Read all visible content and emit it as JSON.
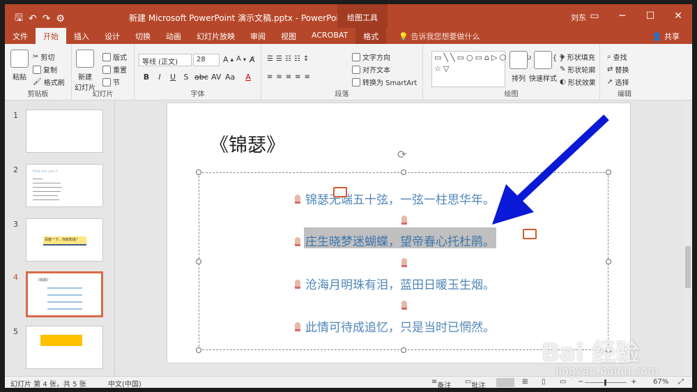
{
  "app": {
    "doc_title": "新建 Microsoft PowerPoint 演示文稿.pptx  -  PowerPoint",
    "context_tools": "绘图工具",
    "user": "刘东"
  },
  "tabs": [
    "文件",
    "开始",
    "插入",
    "设计",
    "切换",
    "动画",
    "幻灯片放映",
    "审阅",
    "视图",
    "ACROBAT",
    "格式"
  ],
  "active_tab": "开始",
  "tellme": "告诉我您想要做什么",
  "share": "共享",
  "ribbon": {
    "clipboard": {
      "paste": "粘贴",
      "cut": "剪切",
      "copy": "复制",
      "format_painter": "格式刷",
      "label": "剪贴板"
    },
    "slides": {
      "new_slide": "新建\n幻灯片",
      "layout": "版式",
      "reset": "重置",
      "section": "节",
      "label": "幻灯片"
    },
    "font": {
      "font_name": "等线 (正文)",
      "font_size": "28",
      "label": "字体"
    },
    "paragraph": {
      "text_direction": "文字方向",
      "align_text": "对齐文本",
      "smartart": "转换为 SmartArt",
      "label": "段落"
    },
    "drawing": {
      "arrange": "排列",
      "quick_styles": "快速样式",
      "shape_fill": "形状填充",
      "shape_outline": "形状轮廓",
      "shape_effects": "形状效果",
      "label": "绘图"
    },
    "editing": {
      "find": "查找",
      "replace": "替换",
      "select": "选择",
      "label": "编辑"
    }
  },
  "thumbnails": {
    "numbers": [
      "1",
      "2",
      "3",
      "4",
      "5"
    ],
    "t2_title": "How are you ?",
    "t3_banner": "百度一下，你就知道！",
    "t4_title": "《锦瑟》"
  },
  "slide": {
    "title": "《锦瑟》",
    "lines": [
      "锦瑟无端五十弦，一弦一柱思华年。",
      "庄生晓梦迷蝴蝶，望帝春心托杜鹃。",
      "沧海月明珠有泪，蓝田日暖玉生烟。",
      "此情可待成追忆，只是当时已惘然。"
    ],
    "selected_line": 1
  },
  "status": {
    "slide_info": "幻灯片 第 4 张，共 5 张",
    "language": "中文(中国)",
    "notes": "备注",
    "comments": "批注",
    "zoom": "67%"
  },
  "watermark": {
    "brand": "Bai 经验",
    "url": "jingyan.baidu.com"
  },
  "colors": {
    "title_bar": "#b7472a",
    "poem_text": "#4f86b8",
    "arrow": "#0a19d6",
    "selection": "#c0c0c0"
  }
}
